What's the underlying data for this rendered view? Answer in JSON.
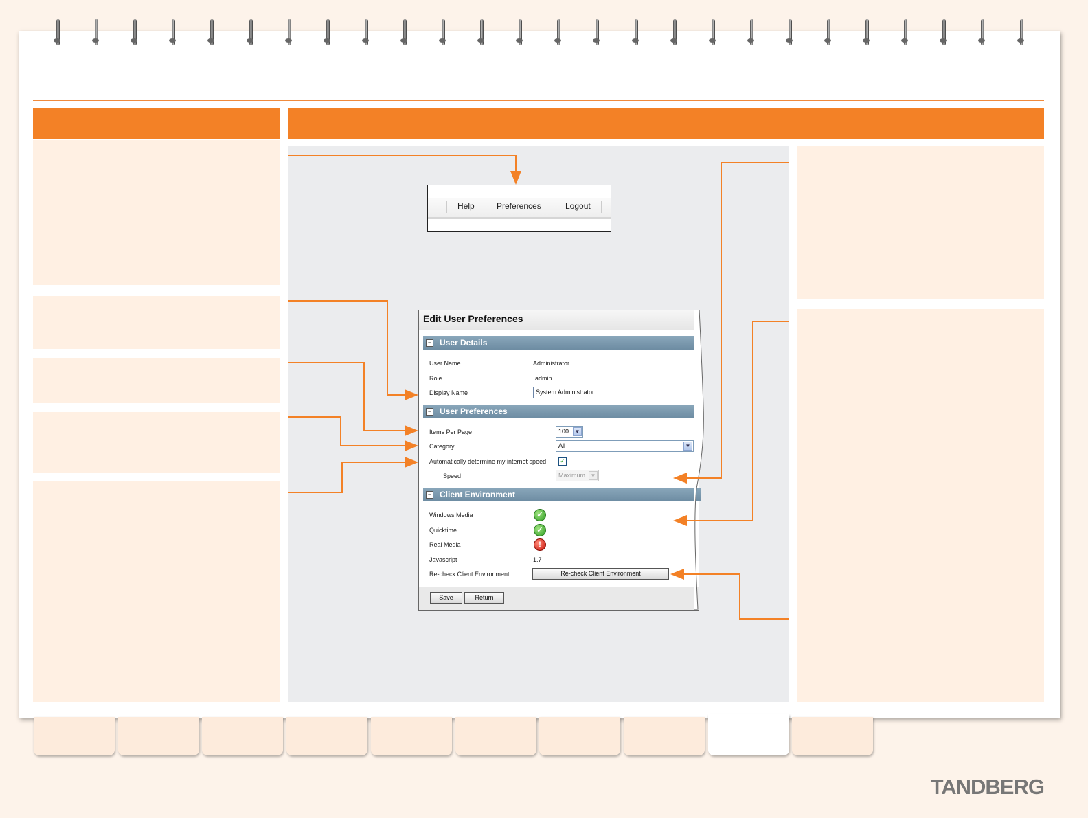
{
  "menu": {
    "help": "Help",
    "preferences": "Preferences",
    "logout": "Logout"
  },
  "dialog": {
    "title": "Edit User Preferences",
    "user_details": {
      "header": "User Details",
      "user_name_label": "User Name",
      "user_name_value": "Administrator",
      "role_label": "Role",
      "role_value": "admin",
      "display_name_label": "Display Name",
      "display_name_value": "System Administrator"
    },
    "user_preferences": {
      "header": "User Preferences",
      "items_per_page_label": "Items Per Page",
      "items_per_page_value": "100",
      "category_label": "Category",
      "category_value": "All",
      "auto_speed_label": "Automatically determine my internet speed",
      "auto_speed_checked": true,
      "speed_label": "Speed",
      "speed_value": "Maximum"
    },
    "client_environment": {
      "header": "Client Environment",
      "windows_media_label": "Windows Media",
      "windows_media_status": "check-icon",
      "quicktime_label": "Quicktime",
      "quicktime_status": "check-icon",
      "real_media_label": "Real Media",
      "real_media_status": "error-icon",
      "javascript_label": "Javascript",
      "javascript_value": "1.7",
      "recheck_label": "Re-check Client Environment",
      "recheck_button": "Re-check Client Environment"
    },
    "save_button": "Save",
    "return_button": "Return"
  },
  "colors": {
    "accent": "#f38126",
    "panel": "#fff0e3",
    "section_header": "#7796ab"
  },
  "logo": "TANDBERG"
}
